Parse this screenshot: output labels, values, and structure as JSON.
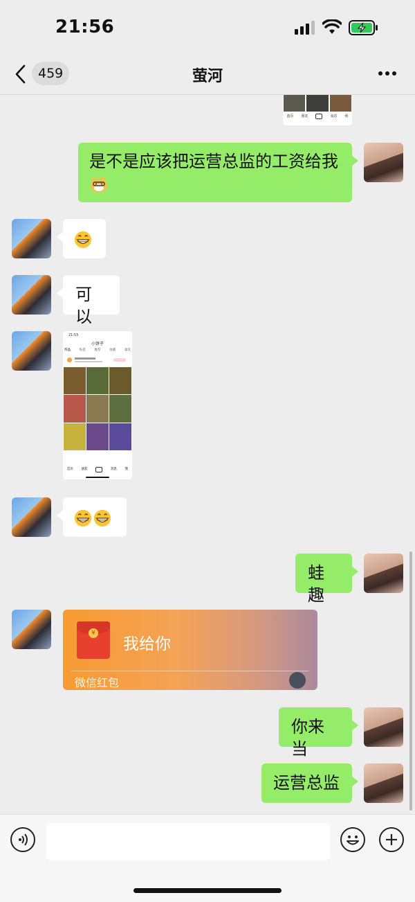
{
  "status_bar": {
    "time": "21:56"
  },
  "header": {
    "back_count": "459",
    "title": "萤河"
  },
  "messages": {
    "m1": {
      "text": "是不是应该把运营总监的工资给我"
    },
    "m3": {
      "text": "可以"
    },
    "m4": {
      "screenshot": {
        "time": "21:55",
        "title": "小饼子",
        "tabs": [
          "作品",
          "私密",
          "推荐",
          "收藏",
          "喜欢"
        ],
        "bottom_nav": [
          "首页",
          "朋友",
          "",
          "消息",
          "我"
        ]
      }
    },
    "m6": {
      "text": "蛙趣"
    },
    "m7": {
      "red_packet_text": "我给你",
      "red_packet_label": "微信红包"
    },
    "m8": {
      "text": "你来当"
    },
    "m9": {
      "text": "运营总监"
    }
  },
  "top_snippet": {
    "tabs": [
      "首页",
      "朋友",
      "",
      "消息",
      "我"
    ]
  },
  "colors": {
    "my_bubble": "#95ec69",
    "their_bubble": "#ffffff",
    "background": "#ededed",
    "red_packet": "#f79c32"
  },
  "icons": [
    "back-icon",
    "more-icon",
    "signal-icon",
    "wifi-icon",
    "battery-icon",
    "voice-icon",
    "emoji-icon",
    "plus-icon"
  ]
}
